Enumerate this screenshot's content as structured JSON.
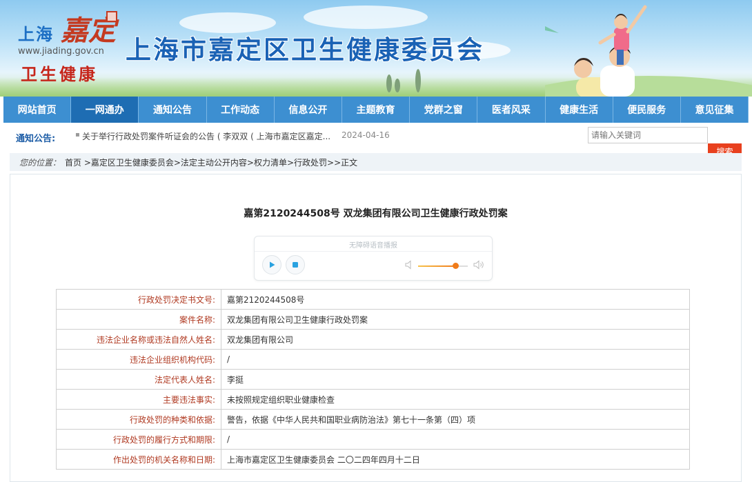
{
  "header": {
    "logo_city": "上海",
    "logo_district": "嘉定",
    "logo_url": "www.jiading.gov.cn",
    "logo_sub": "卫生健康",
    "site_title": "上海市嘉定区卫生健康委员会"
  },
  "nav": {
    "items": [
      {
        "label": "网站首页"
      },
      {
        "label": "一网通办",
        "active": true
      },
      {
        "label": "通知公告"
      },
      {
        "label": "工作动态"
      },
      {
        "label": "信息公开"
      },
      {
        "label": "主题教育"
      },
      {
        "label": "党群之窗"
      },
      {
        "label": "医者风采"
      },
      {
        "label": "健康生活"
      },
      {
        "label": "便民服务"
      },
      {
        "label": "意见征集"
      }
    ]
  },
  "notice": {
    "label": "通知公告:",
    "bullet": "▪",
    "text": "关于举行行政处罚案件听证会的公告 ( 李双双 ( 上海市嘉定区嘉定...",
    "date": "2024-04-16"
  },
  "search": {
    "placeholder": "请输入关键词",
    "button_label": "搜索"
  },
  "breadcrumb": {
    "label": "您的位置：",
    "path": "首页 >嘉定区卫生健康委员会>法定主动公开内容>权力清单>行政处罚>>正文"
  },
  "document": {
    "title": "嘉第2120244508号 双龙集团有限公司卫生健康行政处罚案"
  },
  "player": {
    "hint": "无障碍语音播报",
    "volume_level": 0.75
  },
  "table": {
    "rows": [
      {
        "key": "行政处罚决定书文号:",
        "value": "嘉第2120244508号"
      },
      {
        "key": "案件名称:",
        "value": "双龙集团有限公司卫生健康行政处罚案"
      },
      {
        "key": "违法企业名称或违法自然人姓名:",
        "value": "双龙集团有限公司"
      },
      {
        "key": "违法企业组织机构代码:",
        "value": "/"
      },
      {
        "key": "法定代表人姓名:",
        "value": "李挺"
      },
      {
        "key": "主要违法事实:",
        "value": "未按照规定组织职业健康检查"
      },
      {
        "key": "行政处罚的种类和依据:",
        "value": "警告，依据《中华人民共和国职业病防治法》第七十一条第（四）项"
      },
      {
        "key": "行政处罚的履行方式和期限:",
        "value": "/"
      },
      {
        "key": "作出处罚的机关名称和日期:",
        "value": "上海市嘉定区卫生健康委员会 二〇二四年四月十二日"
      }
    ]
  },
  "colors": {
    "nav_bg": "#3d8fd1",
    "nav_active": "#1e6db3",
    "accent_red": "#e8401e",
    "label_red": "#b03a22"
  }
}
